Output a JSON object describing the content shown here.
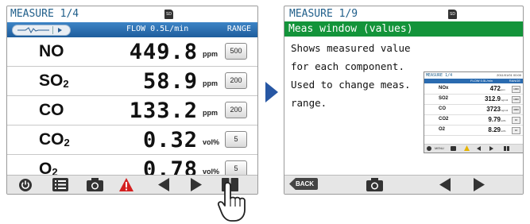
{
  "left_screen": {
    "title": "MEASURE 1/4",
    "sd_label": "SD",
    "flow": "FLOW 0.5L/min",
    "range_header": "RANGE",
    "rows": [
      {
        "name": "NO",
        "sub": "",
        "value": "449.8",
        "unit": "ppm",
        "range": "500"
      },
      {
        "name": "SO",
        "sub": "2",
        "value": "58.9",
        "unit": "ppm",
        "range": "200"
      },
      {
        "name": "CO",
        "sub": "",
        "value": "133.2",
        "unit": "ppm",
        "range": "200"
      },
      {
        "name": "CO",
        "sub": "2",
        "value": "0.32",
        "unit": "vol%",
        "range": "5"
      },
      {
        "name": "O",
        "sub": "2",
        "value": "0.78",
        "unit": "vol%",
        "range": "5"
      }
    ],
    "toolbar_icons": [
      "power-icon",
      "menu-list-icon",
      "camera-icon",
      "warning-icon",
      "left-arrow-icon",
      "right-arrow-icon",
      "info-book-icon"
    ]
  },
  "right_screen": {
    "title": "MEASURE 1/9",
    "sd_label": "SD",
    "heading": "Meas window (values)",
    "description": [
      "Shows measured value",
      "for each component.",
      "Used to change meas.",
      "range."
    ],
    "back_label": "BACK",
    "thumbnail": {
      "title": "MEASURE 1/4",
      "date": "2011/01/01 00:00",
      "flow": "FLOW 0.5L/min",
      "range_header": "RANGE",
      "rows": [
        {
          "name": "NOx",
          "value": "472",
          "unit": "ppm",
          "range": "1000"
        },
        {
          "name": "SO2",
          "value": "312.9",
          "unit": "mg/m3",
          "range": "1000"
        },
        {
          "name": "CO",
          "value": "3723",
          "unit": "mg/m3",
          "range": "4000"
        },
        {
          "name": "CO2",
          "value": "9.79",
          "unit": "vol%",
          "range": "10"
        },
        {
          "name": "O2",
          "value": "8.29",
          "unit": "vol%",
          "range": "10"
        }
      ],
      "menu_label": "MENU"
    }
  }
}
